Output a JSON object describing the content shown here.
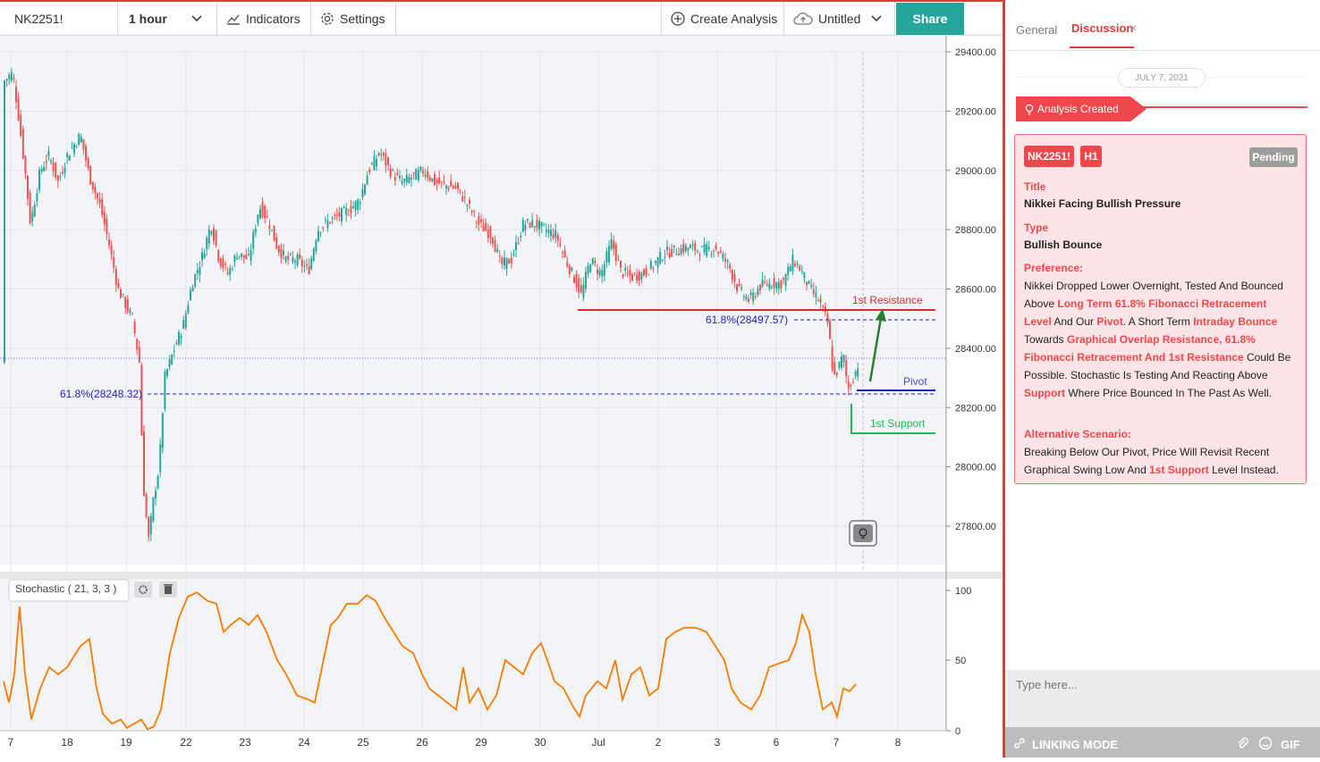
{
  "toolbar": {
    "symbol": "NK2251!",
    "interval": "1 hour",
    "indicators_label": "Indicators",
    "settings_label": "Settings",
    "create_analysis_label": "Create Analysis",
    "layout_name": "Untitled",
    "share_label": "Share"
  },
  "chart": {
    "price_ticks": [
      "29400.00",
      "29200.00",
      "29000.00",
      "28800.00",
      "28600.00",
      "28400.00",
      "28200.00",
      "28000.00",
      "27800.00"
    ],
    "date_ticks": [
      "7",
      "18",
      "19",
      "22",
      "23",
      "24",
      "25",
      "26",
      "29",
      "30",
      "Jul",
      "2",
      "3",
      "6",
      "7",
      "8"
    ],
    "annotations": {
      "resistance": "1st Resistance",
      "fib_upper": "61.8%(28497.57)",
      "pivot": "Pivot",
      "fib_lower": "61.8%(28248.32)",
      "support": "1st Support"
    },
    "colors": {
      "up": "#26a69a",
      "down": "#ef5350",
      "resistance": "#d32f2f",
      "support": "#1db954",
      "fib": "#1f1fbf",
      "stoch": "#f57c00",
      "arrow": "#2e7d32"
    }
  },
  "stochastic": {
    "label": "Stochastic ( 21, 3, 3 )",
    "ticks": [
      "100",
      "50",
      "0"
    ]
  },
  "chart_data": {
    "type": "line",
    "title": "NK2251! 1 hour",
    "x": [
      "7",
      "18",
      "19",
      "22",
      "23",
      "24",
      "25",
      "26",
      "29",
      "30",
      "Jul",
      "2",
      "3",
      "6",
      "7"
    ],
    "series": [
      {
        "name": "NK2251!",
        "values": [
          29300,
          28920,
          27820,
          28700,
          28850,
          28700,
          29030,
          28960,
          28800,
          28780,
          28650,
          28750,
          28750,
          28620,
          28380
        ]
      }
    ],
    "ylim": [
      27700,
      29420
    ],
    "levels": [
      28530,
      28497.57,
      28258,
      28248.32,
      28120
    ]
  },
  "sidebar": {
    "tab_general": "General",
    "tab_discussion": "Discussion",
    "close_glyph": "×",
    "date": "JULY 7, 2021",
    "banner": "Analysis Created",
    "card": {
      "symbol": "NK2251!",
      "timeframe": "H1",
      "status": "Pending",
      "title_label": "Title",
      "title": "Nikkei Facing Bullish Pressure",
      "type_label": "Type",
      "type": "Bullish Bounce",
      "pref_label": "Preference:",
      "pref": [
        [
          "Nikkei Dropped Lower Overnight, Tested And Bounced ",
          false
        ],
        [
          "Above ",
          false
        ],
        [
          "Long Term 61.8% Fibonacci Retracement Level",
          true
        ],
        [
          " And Our ",
          false
        ],
        [
          "Pivot",
          true
        ],
        [
          ". A Short Term ",
          false
        ],
        [
          "Intraday Bounce",
          true
        ],
        [
          " Towards ",
          false
        ],
        [
          "Graphical Overlap Resistance, 61.8% Fibonacci Retracement And 1st Resistance",
          true
        ],
        [
          " Could Be Possible. Stochastic Is Testing And Reacting Above ",
          false
        ],
        [
          "Support",
          true
        ],
        [
          " Where Price Bounced In The Past As Well.",
          false
        ]
      ],
      "alt_label": "Alternative Scenario:",
      "alt": [
        [
          "Breaking Below Our Pivot, Price Will Revisit Recent Graphical Swing Low And ",
          false
        ],
        [
          "1st Support",
          true
        ],
        [
          " Level Instead.",
          false
        ]
      ]
    },
    "input_placeholder": "Type here...",
    "linking_label": "LINKING MODE",
    "gif_label": "GIF"
  }
}
